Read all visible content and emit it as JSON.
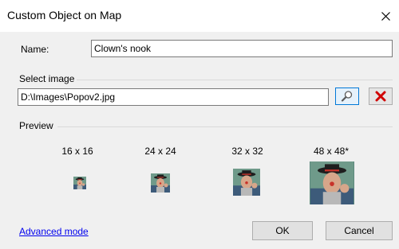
{
  "window": {
    "title": "Custom Object on Map",
    "close_glyph": "close-icon"
  },
  "name_field": {
    "label": "Name:",
    "value": "Clown's nook"
  },
  "image_field": {
    "label": "Select image",
    "value": "D:\\Images\\Popov2.jpg",
    "browse_icon": "search-icon",
    "clear_icon": "delete-x-icon"
  },
  "preview": {
    "label": "Preview",
    "sizes": [
      "16 x 16",
      "24 x 24",
      "32 x 32",
      "48 x 48*"
    ]
  },
  "footer": {
    "advanced_link": "Advanced mode",
    "ok_label": "OK",
    "cancel_label": "Cancel"
  },
  "colors": {
    "link": "#0000ee",
    "clear_icon": "#d00000",
    "browse_border": "#0078d7"
  }
}
